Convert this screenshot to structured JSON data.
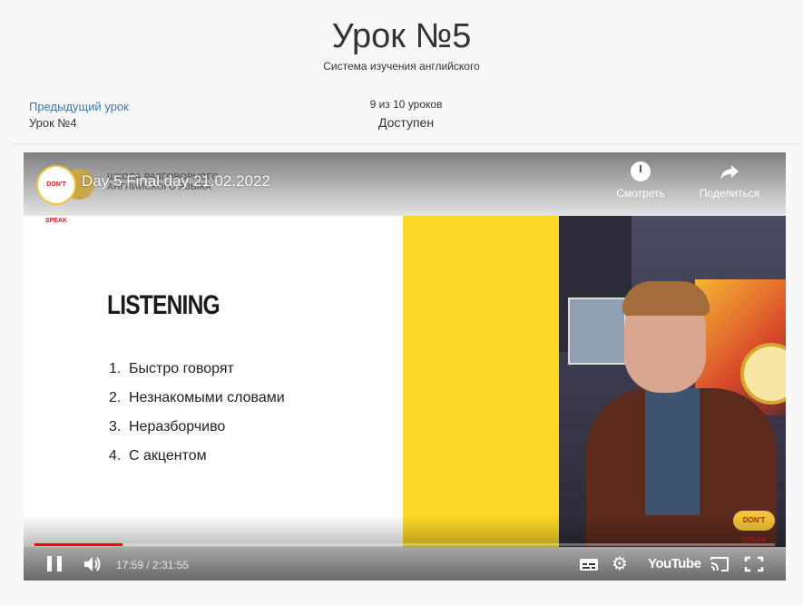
{
  "header": {
    "title": "Урок №5",
    "subtitle": "Система изучения английского"
  },
  "nav": {
    "prev_link": "Предыдущий урок",
    "prev_name": "Урок №4",
    "progress": "9 из 10 уроков",
    "status": "Доступен"
  },
  "video": {
    "title": "Day 5 Final day 21.02.2022",
    "brand_sub": "ШКОЛА РАЗГОВОРНОГО АНГЛИЙСКОГО ЯЗЫКА",
    "channel_logo_text": "DON'T SPEAK",
    "watermark_text": "DON'T SPEAK",
    "watch_later_label": "Смотреть",
    "share_label": "Поделиться",
    "time": "17:59 / 2:31:55",
    "progress_fraction": 0.119,
    "youtube_label": "YouTube",
    "progress_color": "#ff0000",
    "icons": [
      "clock-icon",
      "share-arrow-icon",
      "pause-icon",
      "volume-icon",
      "subtitles-icon",
      "gear-icon",
      "cast-icon",
      "fullscreen-icon"
    ]
  },
  "slide": {
    "heading": "LISTENING",
    "items": [
      {
        "num": "1.",
        "text": "Быстро говорят"
      },
      {
        "num": "2.",
        "text": "Незнакомыми словами"
      },
      {
        "num": "3.",
        "text": "Неразборчиво"
      },
      {
        "num": "4.",
        "text": "С акцентом"
      }
    ],
    "accent": "#fbd926"
  }
}
